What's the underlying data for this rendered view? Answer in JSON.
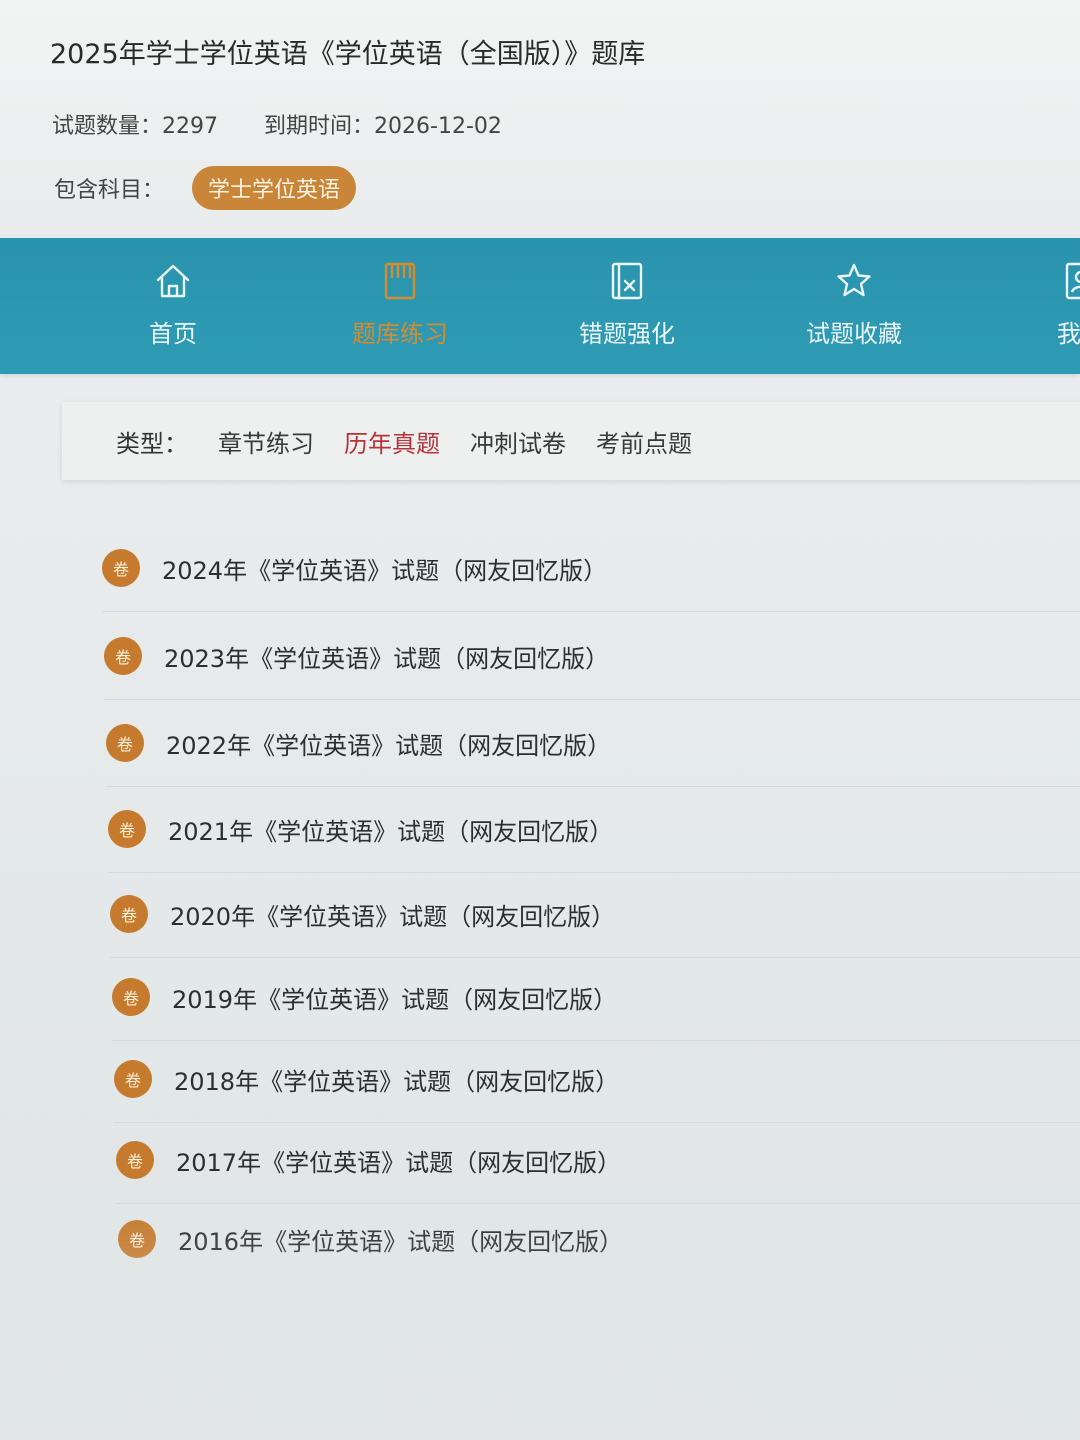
{
  "header": {
    "title": "2025年学士学位英语《学位英语（全国版）》题库",
    "question_count_label": "试题数量：",
    "question_count": "2297",
    "expiry_label": "到期时间：",
    "expiry_date": "2026-12-02",
    "subjects_label": "包含科目：",
    "subject_tag": "学士学位英语"
  },
  "nav": {
    "items": [
      {
        "label": "首页",
        "icon": "home-icon"
      },
      {
        "label": "题库练习",
        "icon": "book-icon",
        "active": true
      },
      {
        "label": "错题强化",
        "icon": "wrong-question-icon"
      },
      {
        "label": "试题收藏",
        "icon": "star-icon"
      },
      {
        "label": "我的",
        "icon": "user-icon"
      }
    ],
    "active_color": "#d68c2e",
    "bar_color": "#2e9bb4"
  },
  "filter": {
    "label": "类型：",
    "options": [
      "章节练习",
      "历年真题",
      "冲刺试卷",
      "考前点题"
    ],
    "active_index": 1,
    "active_color": "#b8323a"
  },
  "papers": {
    "badge": "卷",
    "badge_color": "#c57a2e",
    "items": [
      "2024年《学位英语》试题（网友回忆版）",
      "2023年《学位英语》试题（网友回忆版）",
      "2022年《学位英语》试题（网友回忆版）",
      "2021年《学位英语》试题（网友回忆版）",
      "2020年《学位英语》试题（网友回忆版）",
      "2019年《学位英语》试题（网友回忆版）",
      "2018年《学位英语》试题（网友回忆版）",
      "2017年《学位英语》试题（网友回忆版）",
      "2016年《学位英语》试题（网友回忆版）"
    ]
  }
}
